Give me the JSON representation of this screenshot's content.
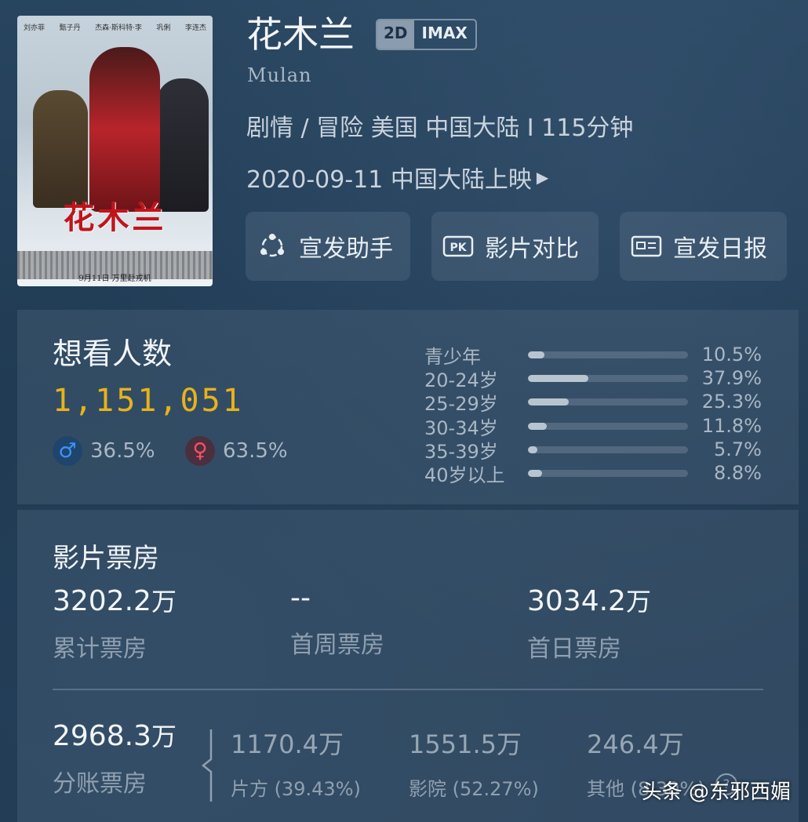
{
  "movie": {
    "title_cn": "花木兰",
    "tags": [
      "2D",
      "IMAX"
    ],
    "title_en": "Mulan",
    "meta": "剧情 / 冒险 美国 中国大陆 I 115分钟",
    "release": "2020-09-11 中国大陆上映",
    "poster": {
      "credits": [
        "刘亦菲",
        "甄子丹",
        "杰森·斯科特·李",
        "巩俐",
        "李连杰"
      ],
      "title": "花木兰",
      "date_line": "9月11日   万里赴戎机"
    }
  },
  "buttons": [
    {
      "label": "宣发助手",
      "icon": "share-network-icon"
    },
    {
      "label": "影片对比",
      "icon": "pk-badge-icon"
    },
    {
      "label": "宣发日报",
      "icon": "report-card-icon"
    }
  ],
  "want": {
    "heading": "想看人数",
    "count": "1,151,051",
    "male_pct": "36.5%",
    "female_pct": "63.5%",
    "ages": [
      {
        "label": "青少年",
        "value": "10.5%",
        "fraction": 0.105
      },
      {
        "label": "20-24岁",
        "value": "37.9%",
        "fraction": 0.379
      },
      {
        "label": "25-29岁",
        "value": "25.3%",
        "fraction": 0.253
      },
      {
        "label": "30-34岁",
        "value": "11.8%",
        "fraction": 0.118
      },
      {
        "label": "35-39岁",
        "value": "5.7%",
        "fraction": 0.057
      },
      {
        "label": "40岁以上",
        "value": "8.8%",
        "fraction": 0.088
      }
    ]
  },
  "boxoffice": {
    "heading": "影片票房",
    "total": {
      "value": "3202.2",
      "unit": "万",
      "label": "累计票房"
    },
    "first_week": {
      "value": "--",
      "label": "首周票房"
    },
    "first_day": {
      "value": "3034.2",
      "unit": "万",
      "label": "首日票房"
    },
    "split": {
      "value": "2968.3",
      "unit": "万",
      "label": "分账票房"
    },
    "parts": [
      {
        "value": "1170.4万",
        "label": "片方 (39.43%)"
      },
      {
        "value": "1551.5万",
        "label": "影院 (52.27%)"
      },
      {
        "value": "246.4万",
        "label": "其他 (8.30%)"
      }
    ]
  },
  "watermark": "头条 @东邪西媚"
}
